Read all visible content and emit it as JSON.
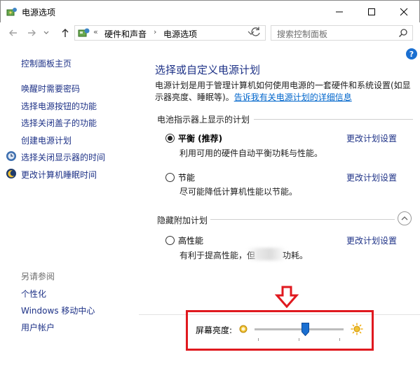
{
  "window": {
    "title": "电源选项"
  },
  "address": {
    "prefix": "«",
    "crumb1": "硬件和声音",
    "sep": "›",
    "crumb2": "电源选项"
  },
  "search": {
    "placeholder": "搜索控制面板"
  },
  "sidebar": {
    "home": "控制面板主页",
    "items": [
      "唤醒时需要密码",
      "选择电源按钮的功能",
      "选择关闭盖子的功能",
      "创建电源计划",
      "选择关闭显示器的时间",
      "更改计算机睡眠时间"
    ],
    "see_also_title": "另请参阅",
    "see_also": [
      "个性化",
      "Windows 移动中心",
      "用户帐户"
    ]
  },
  "main": {
    "title": "选择或自定义电源计划",
    "desc_text": "电源计划是用于管理计算机如何使用电源的一套硬件和系统设置(如显示器亮度、睡眠等)。",
    "desc_link": "告诉我有关电源计划的详细信息",
    "battery_group": "电池指示器上显示的计划",
    "hidden_group": "隐藏附加计划",
    "plans": [
      {
        "name": "平衡 (推荐)",
        "desc": "利用可用的硬件自动平衡功耗与性能。",
        "link": "更改计划设置",
        "selected": true
      },
      {
        "name": "节能",
        "desc": "尽可能降低计算机性能以节能。",
        "link": "更改计划设置",
        "selected": false
      },
      {
        "name": "高性能",
        "desc_start": "有利于提高性能，但",
        "desc_end": "功耗。",
        "link": "更改计划设置",
        "selected": false
      }
    ]
  },
  "brightness": {
    "label": "屏幕亮度:",
    "value_percent": 57
  },
  "colors": {
    "link": "#1e3287",
    "accent": "#1a6fd1",
    "highlight": "#e0191f"
  },
  "icons": {
    "window": "power-options-icon",
    "back": "back-arrow-icon",
    "forward": "forward-arrow-icon",
    "up": "up-arrow-icon",
    "refresh": "refresh-icon",
    "search": "search-icon",
    "help": "help-icon",
    "annotation": "red-down-arrow-icon"
  }
}
